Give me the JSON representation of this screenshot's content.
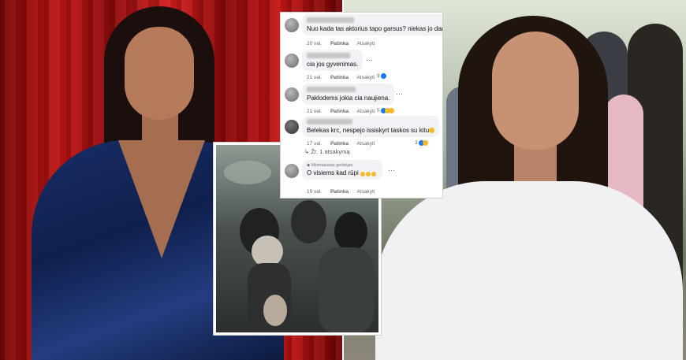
{
  "collage": {
    "left_photo": "woman-in-blue-sequin-gown-red-curtain",
    "right_photo": "woman-in-white-hoodie-smiling-outdoors",
    "middle_photo": "party-crowd-photo"
  },
  "comments_panel": {
    "actions": {
      "like": "Patinka",
      "reply": "Atsakyti"
    },
    "comments": [
      {
        "text": "Nuo kada tas aktorius tapo garsus? niekas jo dar n",
        "time": "20 val.",
        "reactions": ""
      },
      {
        "text": "cia jos gyvenimas.",
        "time": "21 val.",
        "reactions": "9"
      },
      {
        "text": "Paklodems jokia cia naujiena.",
        "time": "21 val.",
        "reactions": "5"
      },
      {
        "text": "Belekas krc, nespejo issiskyrt taskos su kitu",
        "time": "17 val.",
        "reactions": "3"
      },
      {
        "text": "O visiems kad rūpi",
        "time": "19 val.",
        "reactions": "",
        "badge": "Itikimiausias gerbėjas"
      }
    ],
    "replies_link": "Žr. 1 atsakymą"
  },
  "colors": {
    "curtain": "#c21515",
    "gown": "#1a2e66",
    "hoodie": "#f1f1f3",
    "fb_blue": "#1877f2",
    "bubble": "#f0f2f5"
  }
}
